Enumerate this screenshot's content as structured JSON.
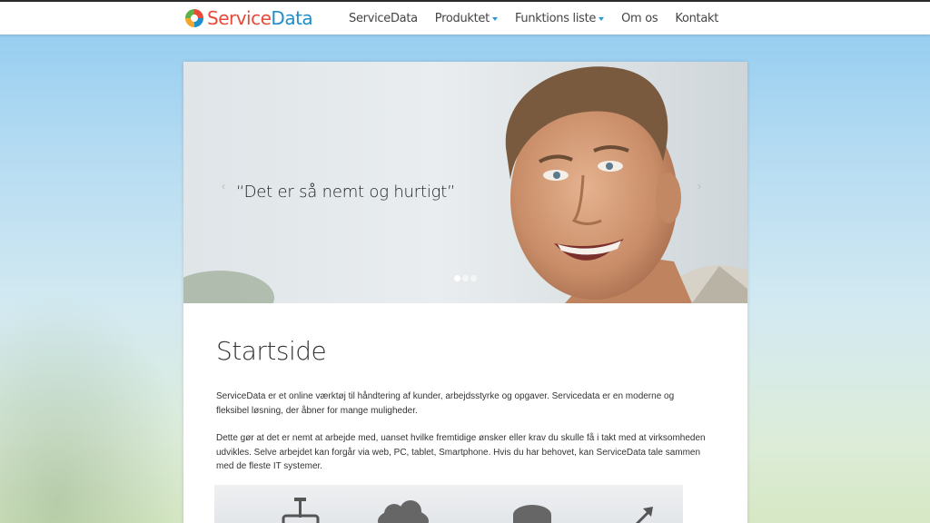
{
  "brand": {
    "name_part1": "Service",
    "name_part2": "Data"
  },
  "nav": {
    "items": [
      {
        "label": "ServiceData",
        "dropdown": false
      },
      {
        "label": "Produktet",
        "dropdown": true
      },
      {
        "label": "Funktions liste",
        "dropdown": true
      },
      {
        "label": "Om os",
        "dropdown": false
      },
      {
        "label": "Kontakt",
        "dropdown": false
      }
    ]
  },
  "hero": {
    "quote": "“Det er så nemt og hurtigt”",
    "prev_glyph": "‹",
    "next_glyph": "›",
    "slide_count": 3,
    "active_slide": 1
  },
  "main": {
    "title": "Startside",
    "paragraphs": [
      "ServiceData er et online værktøj til håndtering af kunder, arbejdsstyrke og opgaver. Servicedata er en moderne og fleksibel løsning, der åbner for mange muligheder.",
      "Dette gør at det er nemt at arbejde med, uanset hvilke fremtidige ønsker eller krav du skulle få i takt med at virksomheden udvikles. Selve arbejdet kan forgår via web, PC, tablet, Smartphone. Hvis du har behovet, kan ServiceData tale sammen med de fleste IT systemer."
    ]
  },
  "colors": {
    "brand_red": "#e84a3a",
    "brand_blue": "#1f8fc9",
    "caret_blue": "#2a9ad6"
  },
  "icons": {
    "logo": "servicedata-logo-icon",
    "diagram": [
      "antenna-icon",
      "cloud-icon",
      "server-icon",
      "arrow-icon"
    ]
  }
}
